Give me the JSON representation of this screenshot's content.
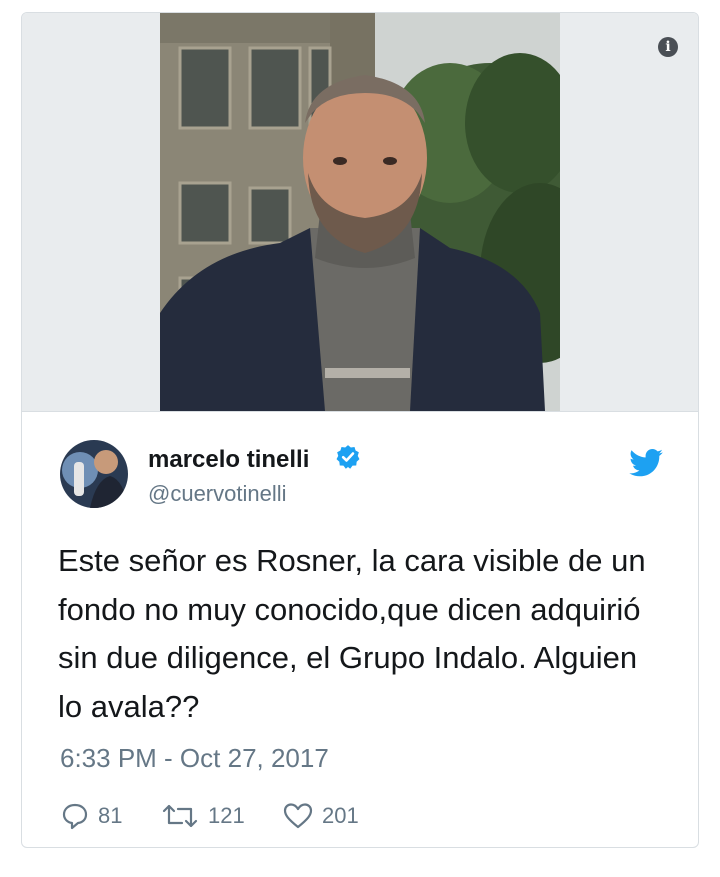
{
  "tweet": {
    "author_name": "marcelo tinelli",
    "author_handle": "@cuervotinelli",
    "text": "Este señor es Rosner, la cara visible de un fondo no muy conocido,que dicen adquirió sin due diligence, el Grupo Indalo. Alguien lo avala??",
    "timestamp": "6:33 PM - Oct 27, 2017",
    "replies": "81",
    "retweets": "121",
    "likes": "201"
  },
  "icons": {
    "info": "info-icon",
    "verified": "verified-badge-icon",
    "brand": "twitter-bird-icon",
    "reply": "reply-icon",
    "retweet": "retweet-icon",
    "like": "heart-icon"
  },
  "colors": {
    "twitter_blue": "#1da1f2",
    "text": "#14171a",
    "secondary_text": "#657786",
    "border": "#d9dee2"
  }
}
